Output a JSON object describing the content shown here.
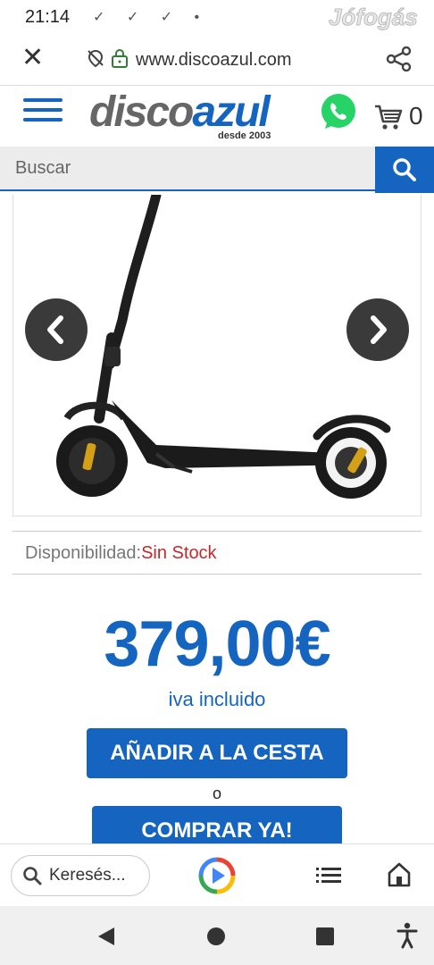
{
  "status_bar": {
    "time": "21:14",
    "notification_icons": "✓ ✓ ✓ •",
    "watermark": "Jófogás"
  },
  "browser": {
    "url": "www.discoazul.com",
    "bottom_search_placeholder": "Keresés..."
  },
  "site": {
    "logo_part1": "disco",
    "logo_part2": "azul",
    "logo_tagline": "desde 2003",
    "cart_count": "0",
    "search_placeholder": "Buscar"
  },
  "product": {
    "availability_label": "Disponibilidad:",
    "availability_value": "Sin Stock",
    "price": "379,00€",
    "tax_note": "iva incluido",
    "add_to_cart_label": "AÑADIR A LA CESTA",
    "or_text": "o",
    "buy_now_label": "COMPRAR YA!"
  },
  "colors": {
    "brand_blue": "#1565c0",
    "out_of_stock_red": "#c62828",
    "whatsapp_green": "#25d366"
  }
}
